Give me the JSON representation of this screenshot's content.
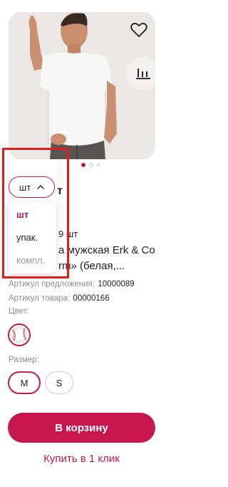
{
  "colors": {
    "accent": "#c8174f",
    "highlight": "#e21b1b"
  },
  "product": {
    "title_fragment": "т",
    "stock_fragment": "9 шт",
    "name_line1": "а мужская Erk & Co",
    "name_line2": "rm» (белая,...",
    "offer_article_label": "Артикул предложения:",
    "offer_article_value": "10000089",
    "item_article_label": "Артикул товара:",
    "item_article_value": "00000166"
  },
  "gallery": {
    "dots_total": 3,
    "active_index": 0
  },
  "icons": {
    "favorite": "heart-icon",
    "compare": "compare-bars-icon",
    "unit_chevron": "chevron-up-icon"
  },
  "unit_selector": {
    "value": "шт",
    "options": [
      "шт",
      "упак.",
      "компл."
    ]
  },
  "color": {
    "label": "Цвет:"
  },
  "size": {
    "label": "Размер:",
    "options": [
      "M",
      "S"
    ],
    "selected": "M"
  },
  "actions": {
    "cart_label": "В корзину",
    "oneclick_label": "Купить в 1 клик"
  }
}
